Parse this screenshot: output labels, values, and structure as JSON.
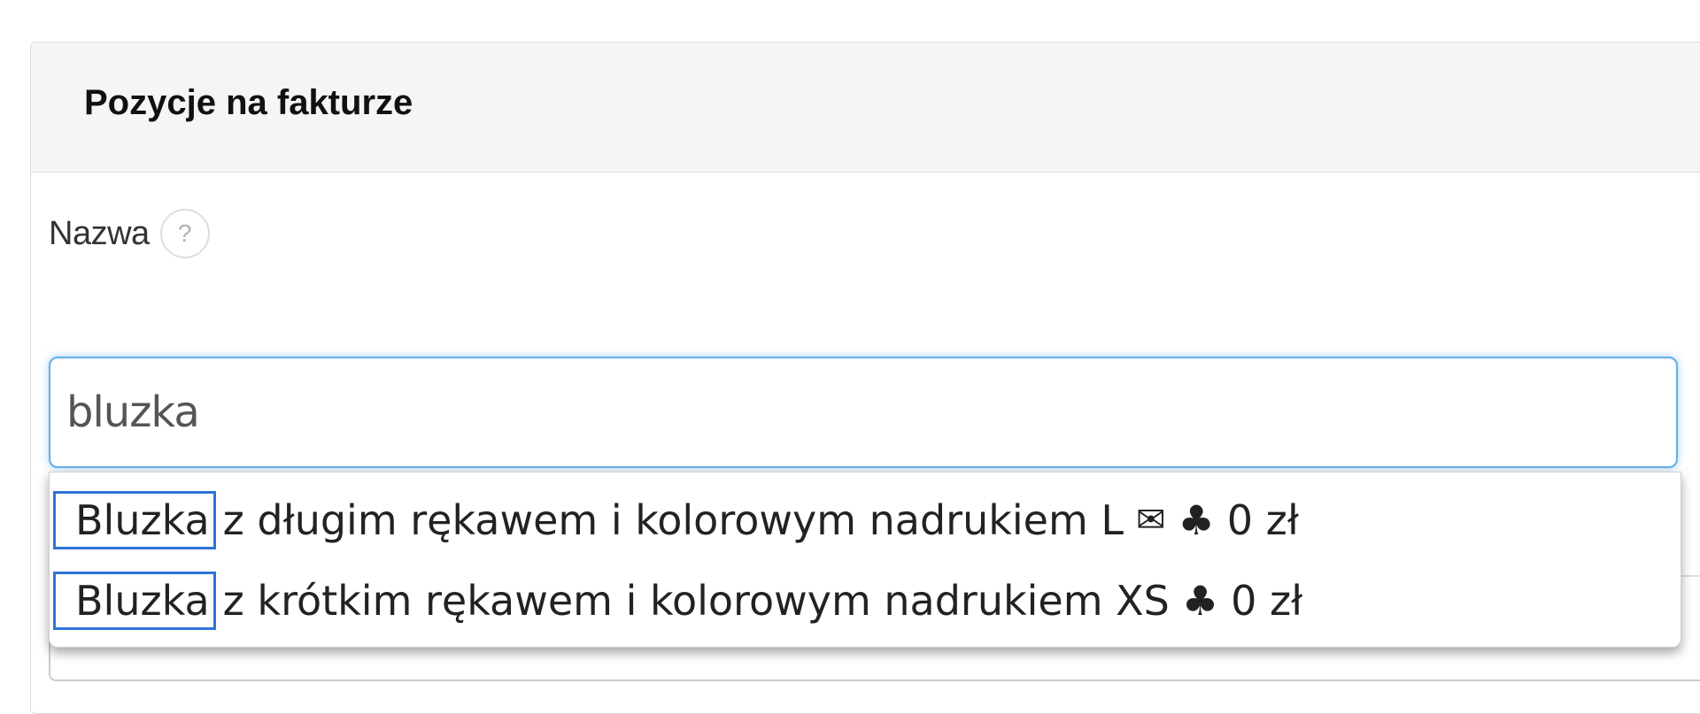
{
  "panel": {
    "title": "Pozycje na fakturze"
  },
  "name_field": {
    "label": "Nazwa",
    "help_icon": "?",
    "value": "bluzka"
  },
  "suggestions": [
    {
      "match": "Bluzka",
      "rest": "z długim rękawem i kolorowym nadrukiem L",
      "icons": [
        "envelope-icon",
        "club-icon"
      ],
      "envelope_glyph": "✉",
      "club_glyph": "♣",
      "price": "0 zł"
    },
    {
      "match": "Bluzka",
      "rest": "z krótkim rękawem i kolorowym nadrukiem XS",
      "icons": [
        "club-icon"
      ],
      "club_glyph": "♣",
      "price": "0 zł"
    }
  ],
  "colors": {
    "focus_border": "#66afe9",
    "match_highlight": "#2f72d9",
    "heading_bg": "#f5f5f5"
  }
}
